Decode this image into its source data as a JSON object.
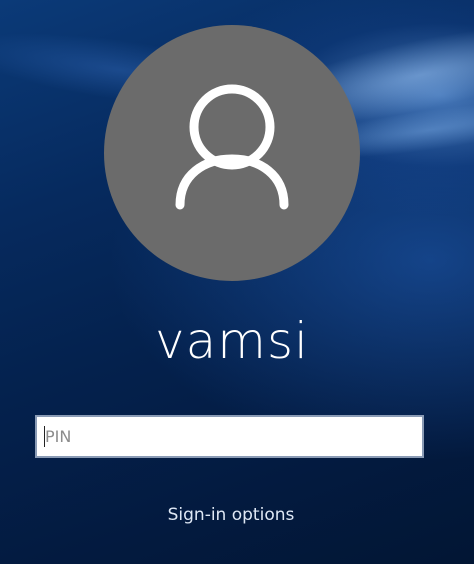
{
  "user": {
    "name": "vamsi",
    "avatar_icon": "user-silhouette-icon"
  },
  "pin": {
    "placeholder": "PIN",
    "value": ""
  },
  "signin_options": {
    "label": "Sign-in options"
  },
  "colors": {
    "background": "#062a5e",
    "avatar_circle": "#6b6b6b",
    "text": "#ffffff",
    "input_border": "#8a9bb5"
  }
}
